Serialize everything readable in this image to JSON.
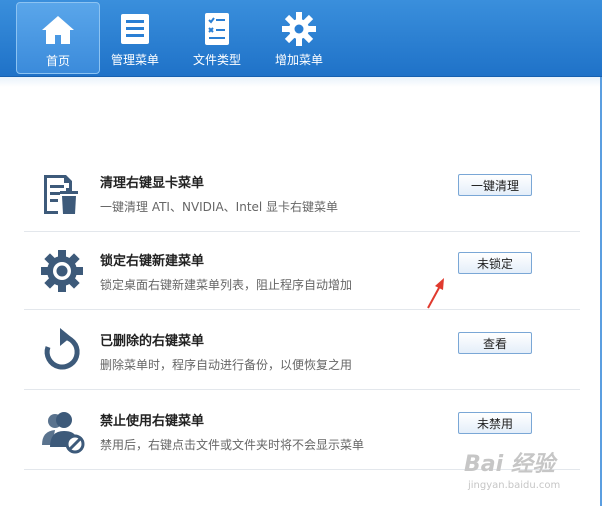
{
  "toolbar": {
    "items": [
      {
        "label": "首页",
        "icon": "home-icon",
        "active": true
      },
      {
        "label": "管理菜单",
        "icon": "list-icon"
      },
      {
        "label": "文件类型",
        "icon": "checklist-icon"
      },
      {
        "label": "增加菜单",
        "icon": "gear-icon"
      }
    ]
  },
  "rows": [
    {
      "title": "清理右键显卡菜单",
      "desc": "一键清理 ATI、NVIDIA、Intel 显卡右键菜单",
      "button": "一键清理",
      "icon": "document-trash-icon"
    },
    {
      "title": "锁定右键新建菜单",
      "desc": "锁定桌面右键新建菜单列表，阻止程序自动增加",
      "button": "未锁定",
      "icon": "gear-icon"
    },
    {
      "title": "已删除的右键菜单",
      "desc": "删除菜单时，程序自动进行备份，以便恢复之用",
      "button": "查看",
      "icon": "restore-icon"
    },
    {
      "title": "禁止使用右键菜单",
      "desc": "禁用后，右键点击文件或文件夹时将不会显示菜单",
      "button": "未禁用",
      "icon": "user-forbidden-icon"
    }
  ],
  "watermark": {
    "main": "Bai 经验",
    "sub": "jingyan.baidu.com"
  },
  "colors": {
    "toolbar": "#2a7fd4",
    "icon_dark": "#3d5a7a",
    "annotation_arrow": "#e03a2e"
  }
}
